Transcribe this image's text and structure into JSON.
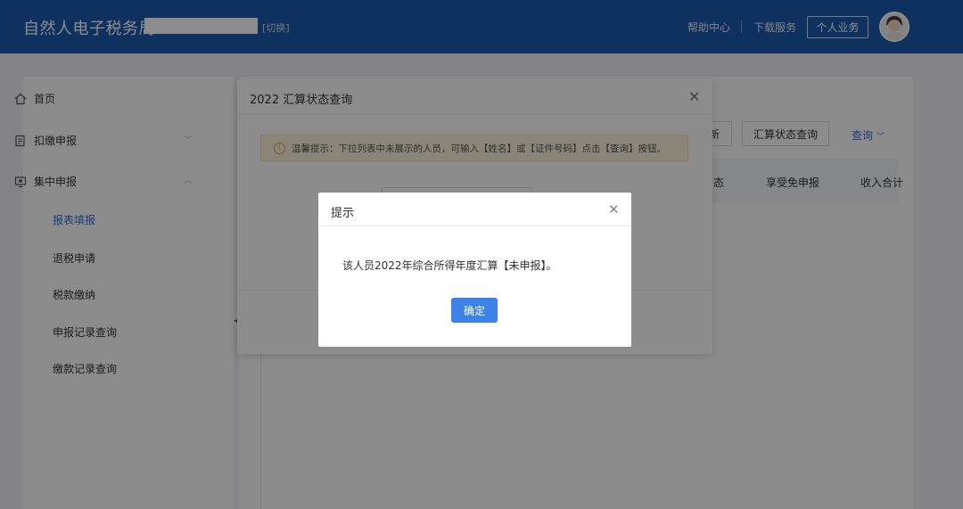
{
  "header": {
    "brand": "自然人电子税务局",
    "switch": "[切换]",
    "help": "帮助中心",
    "download": "下载服务",
    "personal": "个人业务",
    "bg_color": "#1d5ab0"
  },
  "sidebar": {
    "items": [
      {
        "label": "首页",
        "icon": "home-icon"
      },
      {
        "label": "扣缴申报",
        "icon": "document-icon"
      },
      {
        "label": "集中申报",
        "icon": "monitor-icon"
      }
    ],
    "sub_items": [
      "报表填报",
      "退税申请",
      "税款缴纳",
      "申报记录查询",
      "缴款记录查询"
    ],
    "active_sub": "报表填报"
  },
  "main": {
    "toolbar": {
      "refresh": "新",
      "status_query": "汇算状态查询",
      "query": "查询"
    },
    "table_headers": [
      "态",
      "享受免申报",
      "收入合计"
    ]
  },
  "mid_dialog": {
    "title": "2022 汇算状态查询",
    "notice": "温馨提示：下拉列表中未展示的人员，可输入【姓名】或【证件号码】点击【查询】按钮。"
  },
  "alert": {
    "title": "提示",
    "message": "该人员2022年综合所得年度汇算【未申报】。",
    "ok": "确定",
    "ok_color": "#3c82e8"
  }
}
